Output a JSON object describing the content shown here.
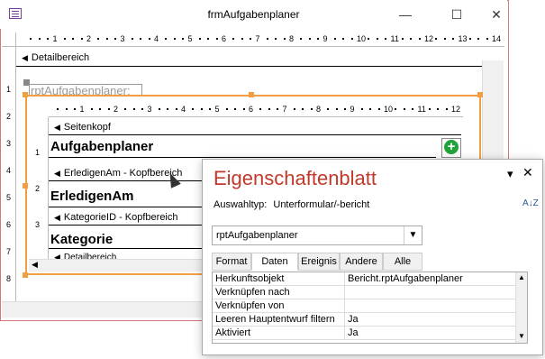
{
  "window": {
    "title": "frmAufgabenplaner",
    "minimize": "—",
    "maximize": "☐",
    "close": "✕"
  },
  "ruler": {
    "top_numbers": [
      "1",
      "2",
      "3",
      "4",
      "5",
      "6",
      "7",
      "8",
      "9",
      "10",
      "11",
      "12",
      "13",
      "14"
    ],
    "left_numbers": [
      "1",
      "2",
      "3",
      "4",
      "5",
      "6",
      "7",
      "8"
    ],
    "inner_top_numbers": [
      "1",
      "2",
      "3",
      "4",
      "5",
      "6",
      "7",
      "8",
      "9",
      "10",
      "11",
      "12"
    ],
    "inner_left_numbers": [
      "1",
      "2",
      "3"
    ]
  },
  "design": {
    "detail_section": "Detailbereich",
    "subform_label": "rptAufgabenplaner:",
    "sections": {
      "page_header": "Seitenkopf",
      "title": "Aufgabenplaner",
      "erledigen_header": "ErledigenAm - Kopfbereich",
      "erledigen_field": "ErledigenAm",
      "kategorie_header": "KategorieID - Kopfbereich",
      "kategorie_field": "Kategorie",
      "detail": "Detailbereich"
    }
  },
  "properties": {
    "title": "Eigenschaftenblatt",
    "selection_type_label": "Auswahltyp:",
    "selection_type_value": "Unterformular/-bericht",
    "object_selected": "rptAufgabenplaner",
    "tabs": [
      "Format",
      "Daten",
      "Ereignis",
      "Andere",
      "Alle"
    ],
    "active_tab": "Daten",
    "rows": [
      {
        "key": "Herkunftsobjekt",
        "value": "Bericht.rptAufgabenplaner"
      },
      {
        "key": "Verknüpfen nach",
        "value": ""
      },
      {
        "key": "Verknüpfen von",
        "value": ""
      },
      {
        "key": "Leeren Hauptentwurf filtern",
        "value": "Ja"
      },
      {
        "key": "Aktiviert",
        "value": "Ja"
      }
    ],
    "sort_icon_label": "A↓Z"
  },
  "colors": {
    "accent": "#c0392b",
    "selection": "#f0a040",
    "add_green": "#21a33a"
  }
}
